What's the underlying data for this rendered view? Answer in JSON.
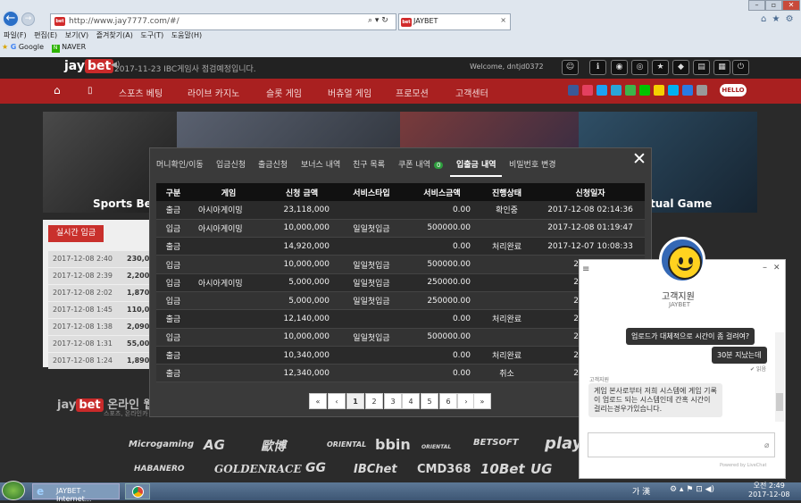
{
  "browser": {
    "url": "http://www.jay7777.com/#/",
    "tab_title": "JAYBET",
    "menu": [
      "파일(F)",
      "편집(E)",
      "보기(V)",
      "즐겨찾기(A)",
      "도구(T)",
      "도움말(H)"
    ],
    "favorites": [
      "Google",
      "NAVER"
    ]
  },
  "site": {
    "logo_a": "jay",
    "logo_b": "bet",
    "notice": "2017-11-23 IBC게임사 점검예정입니다.",
    "welcome": "Welcome, dntjd0372",
    "nav": [
      "스포츠 베팅",
      "라이브 카지노",
      "슬롯 게임",
      "버츄얼 게임",
      "프로모션",
      "고객센터"
    ],
    "hello": "HELLO",
    "banner_sports": "Sports Bet",
    "banner_virtual": "tual Game",
    "realtime_label": "실시간 입금",
    "realtime_rows": [
      {
        "time": "2017-12-08 2:40",
        "amt": "230,0"
      },
      {
        "time": "2017-12-08 2:39",
        "amt": "2,200"
      },
      {
        "time": "2017-12-08 2:02",
        "amt": "1,870"
      },
      {
        "time": "2017-12-08 1:45",
        "amt": "110,0"
      },
      {
        "time": "2017-12-08 1:38",
        "amt": "2,090"
      },
      {
        "time": "2017-12-08 1:31",
        "amt": "55,00"
      },
      {
        "time": "2017-12-08 1:24",
        "amt": "1,890"
      }
    ],
    "footer_title": "온라인 웹",
    "footer_sub": "스포츠, 온라인카",
    "brands": [
      "Microgaming",
      "AG",
      "歐博",
      "ORIENTAL",
      "bbin",
      "ORIENTAL",
      "BETSOFT",
      "play",
      "HABANERO",
      "GOLDENRACE",
      "GG",
      "IBChet",
      "CMD368",
      "10Bet",
      "UG"
    ]
  },
  "modal": {
    "tabs": [
      "머니확인/이동",
      "입금신청",
      "출금신청",
      "보너스 내역",
      "친구 목록",
      "쿠폰 내역",
      "입출금 내역",
      "비밀번호 변경"
    ],
    "coupon_count": "0",
    "active_tab": "입출금 내역",
    "columns": [
      "구분",
      "게임",
      "신청 금액",
      "서비스타입",
      "서비스금액",
      "진행상태",
      "신청일자"
    ],
    "rows": [
      [
        "출금",
        "아시아게이밍",
        "23,118,000",
        "",
        "0.00",
        "확인중",
        "2017-12-08 02:14:36"
      ],
      [
        "입금",
        "아시아게이밍",
        "10,000,000",
        "일일첫입금",
        "500000.00",
        "",
        "2017-12-08 01:19:47"
      ],
      [
        "출금",
        "",
        "14,920,000",
        "",
        "0.00",
        "처리완료",
        "2017-12-07 10:08:33"
      ],
      [
        "입금",
        "",
        "10,000,000",
        "일일첫입금",
        "500000.00",
        "",
        "2017-12"
      ],
      [
        "입금",
        "아시아게이밍",
        "5,000,000",
        "일일첫입금",
        "250000.00",
        "",
        "2017-12"
      ],
      [
        "입금",
        "",
        "5,000,000",
        "일일첫입금",
        "250000.00",
        "",
        "2017-12"
      ],
      [
        "출금",
        "",
        "12,140,000",
        "",
        "0.00",
        "처리완료",
        "2017-11"
      ],
      [
        "입금",
        "",
        "10,000,000",
        "일일첫입금",
        "500000.00",
        "",
        "2017-11"
      ],
      [
        "출금",
        "",
        "10,340,000",
        "",
        "0.00",
        "처리완료",
        "2017-11"
      ],
      [
        "출금",
        "",
        "12,340,000",
        "",
        "0.00",
        "취소",
        "2017-11"
      ]
    ],
    "pages": [
      "«",
      "‹",
      "1",
      "2",
      "3",
      "4",
      "5",
      "6",
      "›",
      "»"
    ],
    "current_page": "1"
  },
  "chat": {
    "title": "고객지원",
    "subtitle": "JAYBET",
    "msg_user_1": "업로드가 대체적으로 시간이 좀 걸려여?",
    "msg_user_2": "30분 지났는데",
    "read_label": "✔ 읽음",
    "agent_name": "고객지원",
    "msg_agent": "게임 본사로부터 저희 시스템에 게임 기록이 업로드 되는 시스템인데 간혹 시간이 걸리는경우가있습니다.",
    "powered": "Powered by LiveChat"
  },
  "taskbar": {
    "ie_label": "JAYBET - Internet...",
    "lang": "가 漢",
    "time": "오전 2:49",
    "date": "2017-12-08"
  }
}
